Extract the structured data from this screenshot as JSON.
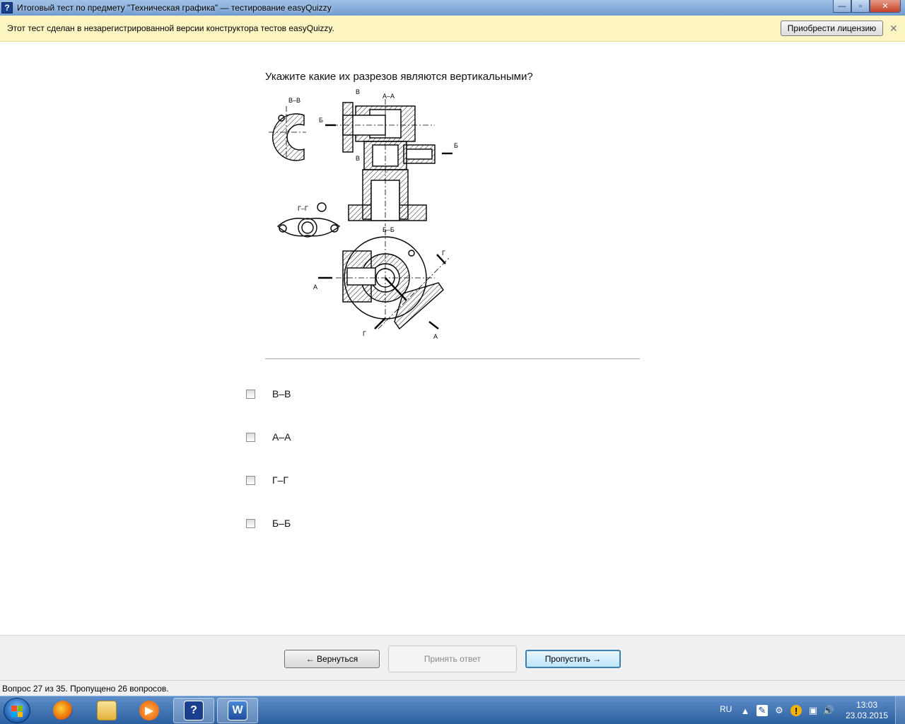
{
  "window": {
    "title": "Итоговый тест по предмету \"Техническая графика\" — тестирование easyQuizzy",
    "app_icon": "?",
    "minimize": "—",
    "maximize": "▫",
    "close": "✕"
  },
  "infobar": {
    "message": "Этот тест сделан в незарегистрированной версии конструктора тестов easyQuizzy.",
    "license_button": "Приобрести лицензию",
    "close_glyph": "✕"
  },
  "question": {
    "text": "Укажите какие их разрезов являются вертикальными?",
    "drawing_labels": {
      "vv": "В–В",
      "aa": "А–А",
      "gg": "Г–Г",
      "bb": "Б–Б",
      "b1": "Б",
      "b2": "Б",
      "v1": "В",
      "v2": "В",
      "a1": "А",
      "a2": "А",
      "g1": "Г",
      "g2": "Г"
    }
  },
  "options": [
    {
      "label": "В–В",
      "checked": false
    },
    {
      "label": "А–А",
      "checked": false
    },
    {
      "label": "Г–Г",
      "checked": false
    },
    {
      "label": "Б–Б",
      "checked": false
    }
  ],
  "nav": {
    "back": "← Вернуться",
    "accept": "Принять ответ",
    "skip": "Пропустить →"
  },
  "status": {
    "text": "Вопрос 27 из 35. Пропущено 26 вопросов."
  },
  "taskbar": {
    "items": [
      {
        "name": "firefox",
        "icon": "firefox-icon"
      },
      {
        "name": "explorer",
        "icon": "folder-icon"
      },
      {
        "name": "media-player",
        "icon": "play-icon"
      },
      {
        "name": "easyquizzy",
        "icon": "question-icon",
        "glyph": "?"
      },
      {
        "name": "word",
        "icon": "word-icon",
        "glyph": "W"
      }
    ],
    "lang": "RU",
    "time": "13:03",
    "date": "23.03.2015"
  },
  "colors": {
    "infobar_bg": "#fdf6c3",
    "taskbar": "#2c5fa0",
    "skip_border": "#3c7fb1"
  }
}
